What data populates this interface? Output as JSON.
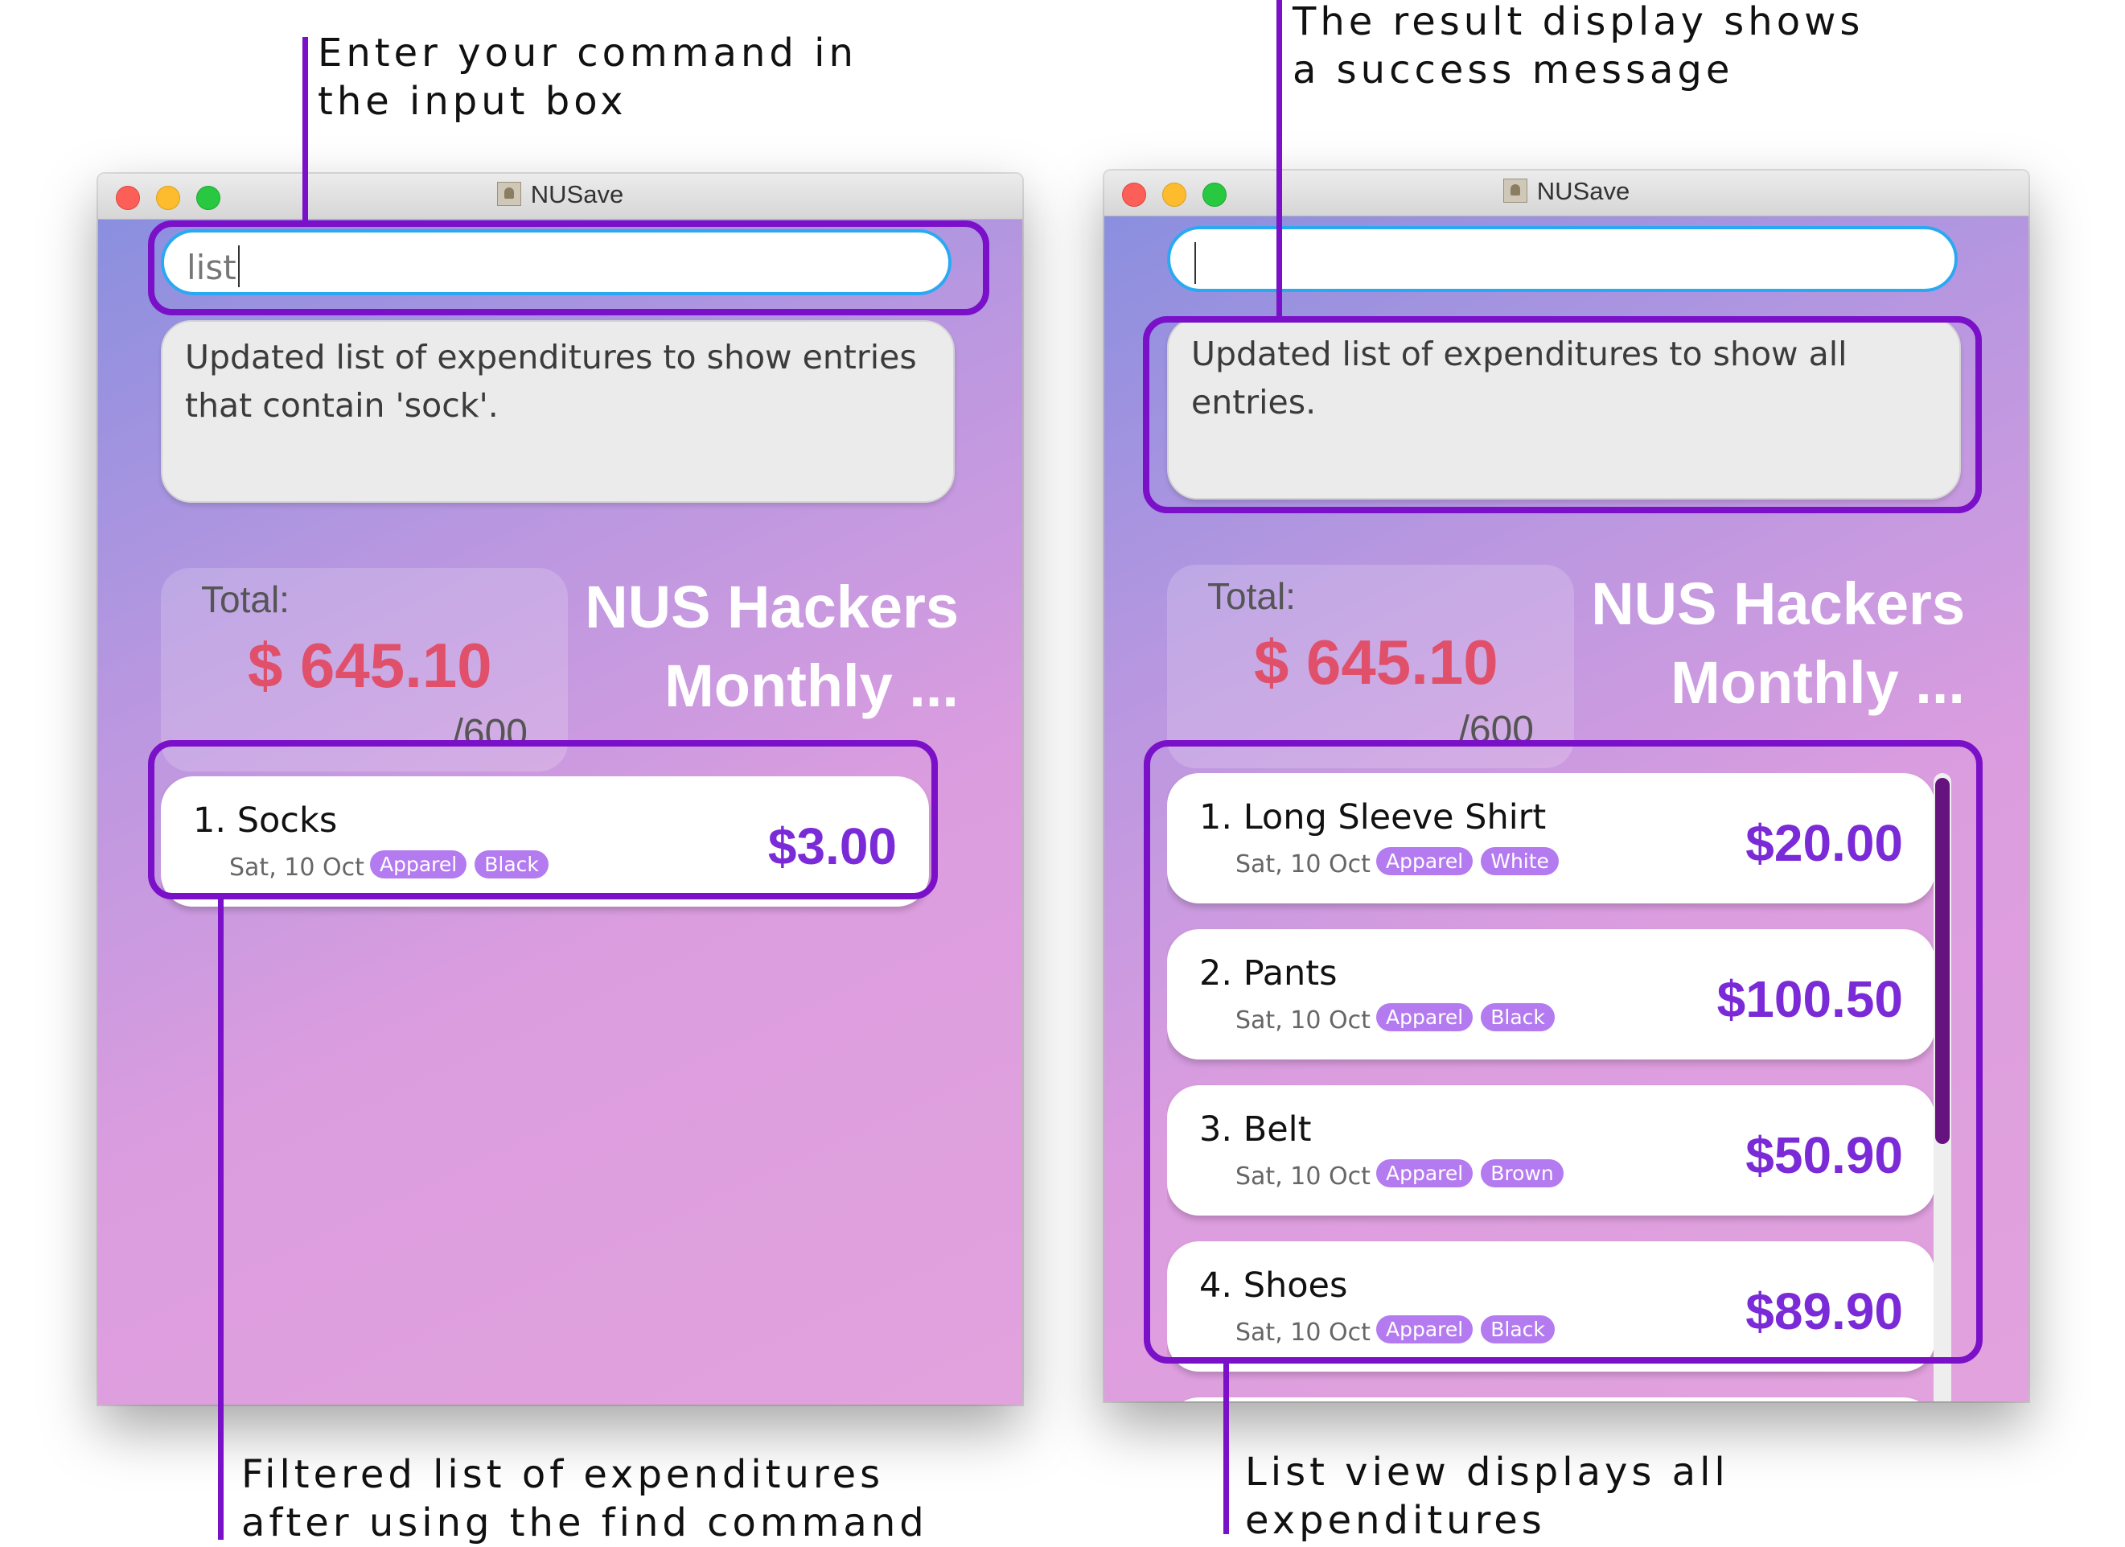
{
  "annotations": {
    "input_box": "Enter your command in\nthe input box",
    "result_display": "The result display shows\na success message",
    "filtered_list": "Filtered list of expenditures\nafter using the find command",
    "list_view": "List view displays all\nexpenditures"
  },
  "windows": [
    {
      "title": "NUSave",
      "command_value": "list",
      "result_text": "Updated list of expenditures to show entries that contain 'sock'.",
      "total_label": "Total:",
      "total_amount": "$ 645.10",
      "total_budget": "/600",
      "list_title": "NUS Hackers Monthly ...",
      "expenditures": [
        {
          "name": "1. Socks",
          "date": "Sat, 10 Oct",
          "tags": [
            "Apparel",
            "Black"
          ],
          "amount": "$3.00"
        }
      ]
    },
    {
      "title": "NUSave",
      "command_value": "",
      "result_text": "Updated list of expenditures to show all entries.",
      "total_label": "Total:",
      "total_amount": "$ 645.10",
      "total_budget": "/600",
      "list_title": "NUS Hackers Monthly ...",
      "expenditures": [
        {
          "name": "1. Long Sleeve Shirt",
          "date": "Sat, 10 Oct",
          "tags": [
            "Apparel",
            "White"
          ],
          "amount": "$20.00"
        },
        {
          "name": "2. Pants",
          "date": "Sat, 10 Oct",
          "tags": [
            "Apparel",
            "Black"
          ],
          "amount": "$100.50"
        },
        {
          "name": "3. Belt",
          "date": "Sat, 10 Oct",
          "tags": [
            "Apparel",
            "Brown"
          ],
          "amount": "$50.90"
        },
        {
          "name": "4. Shoes",
          "date": "Sat, 10 Oct",
          "tags": [
            "Apparel",
            "Black"
          ],
          "amount": "$89.90"
        }
      ]
    }
  ],
  "colors": {
    "highlight": "#7a10c8",
    "total_amount": "#e0506a",
    "card_amount": "#7a2ad6",
    "tag": "#b47bf0",
    "input_border": "#29a9f2"
  }
}
